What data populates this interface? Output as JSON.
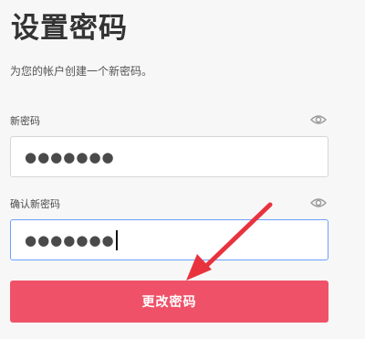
{
  "page": {
    "title": "设置密码",
    "subtitle": "为您的帐户创建一个新密码。"
  },
  "form": {
    "new_password": {
      "label": "新密码",
      "masked_value": "●●●●●●●",
      "toggle_icon": "eye-icon"
    },
    "confirm_password": {
      "label": "确认新密码",
      "masked_value": "●●●●●●●",
      "toggle_icon": "eye-icon"
    },
    "submit_label": "更改密码"
  },
  "colors": {
    "primary_button": "#ef5268",
    "annotation_arrow": "#e8333f",
    "focus_border": "#6b9fff"
  }
}
